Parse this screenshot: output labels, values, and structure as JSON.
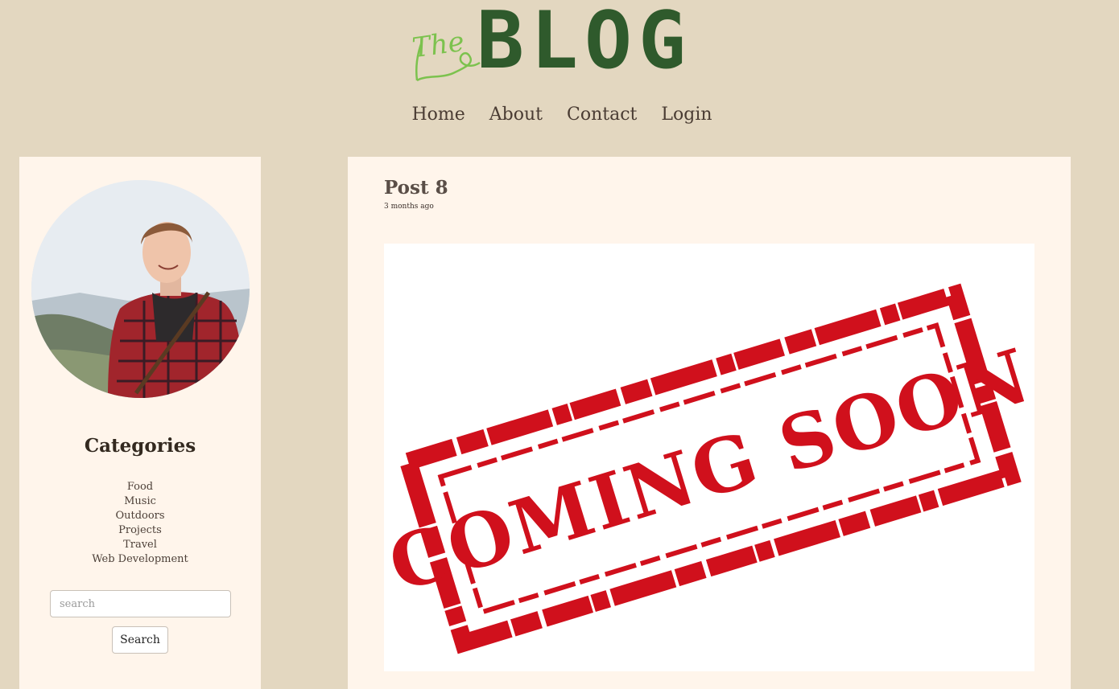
{
  "header": {
    "logo_the": "The",
    "logo_blog": "BLOG"
  },
  "nav": {
    "items": [
      {
        "label": "Home"
      },
      {
        "label": "About"
      },
      {
        "label": "Contact"
      },
      {
        "label": "Login"
      }
    ]
  },
  "sidebar": {
    "categories_title": "Categories",
    "categories": [
      "Food",
      "Music",
      "Outdoors",
      "Projects",
      "Travel",
      "Web Development"
    ],
    "search_placeholder": "search",
    "search_button": "Search"
  },
  "post": {
    "title": "Post 8",
    "date": "3 months ago",
    "image_text": "COMING SOON"
  },
  "colors": {
    "page_bg": "#e3d7c0",
    "panel_bg": "#fff5eb",
    "logo_green": "#2f5a2c",
    "logo_light_green": "#7cc24e",
    "stamp_red": "#d0101c"
  }
}
